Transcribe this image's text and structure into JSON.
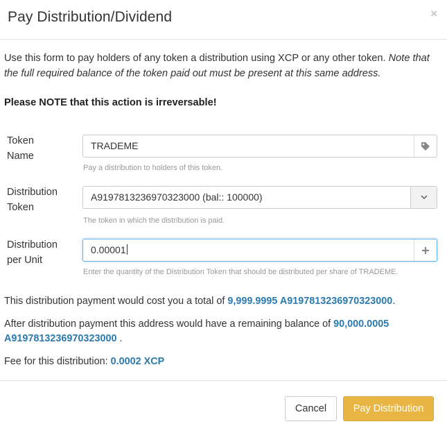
{
  "header": {
    "title": "Pay Distribution/Dividend",
    "close_label": "×"
  },
  "intro": {
    "text": "Use this form to pay holders of any token a distribution using XCP or any other token.",
    "note": "Note that the full required balance of the token paid out must be present at this same address."
  },
  "warning": "Please NOTE that this action is irreversable!",
  "form": {
    "token_name": {
      "label_line1": "Token",
      "label_line2": "Name",
      "value": "TRADEME",
      "help": "Pay a distribution to holders of this token."
    },
    "distribution_token": {
      "label_line1": "Distribution",
      "label_line2": "Token",
      "value": "A9197813236970323000 (bal:: 100000)",
      "help": "The token in which the distribution is paid."
    },
    "distribution_per_unit": {
      "label_line1": "Distribution",
      "label_line2": "per Unit",
      "value": "0.00001",
      "help": "Enter the quantity of the Distribution Token that should be distributed per share of TRADEME."
    }
  },
  "summary": {
    "cost_prefix": "This distribution payment would cost you a total of",
    "cost_value": "9,999.9995 A9197813236970323000",
    "cost_suffix": ".",
    "remaining_prefix": "After distribution payment this address would have a remaining balance of",
    "remaining_value_1": "90,000.0005",
    "remaining_value_2": "A9197813236970323000",
    "remaining_suffix": ".",
    "fee_prefix": "Fee for this distribution:",
    "fee_value": "0.0002 XCP"
  },
  "footer": {
    "cancel_label": "Cancel",
    "pay_label": "Pay Distribution"
  },
  "colors": {
    "accent_value": "#2a7ab0",
    "pay_button": "#e9b646"
  }
}
